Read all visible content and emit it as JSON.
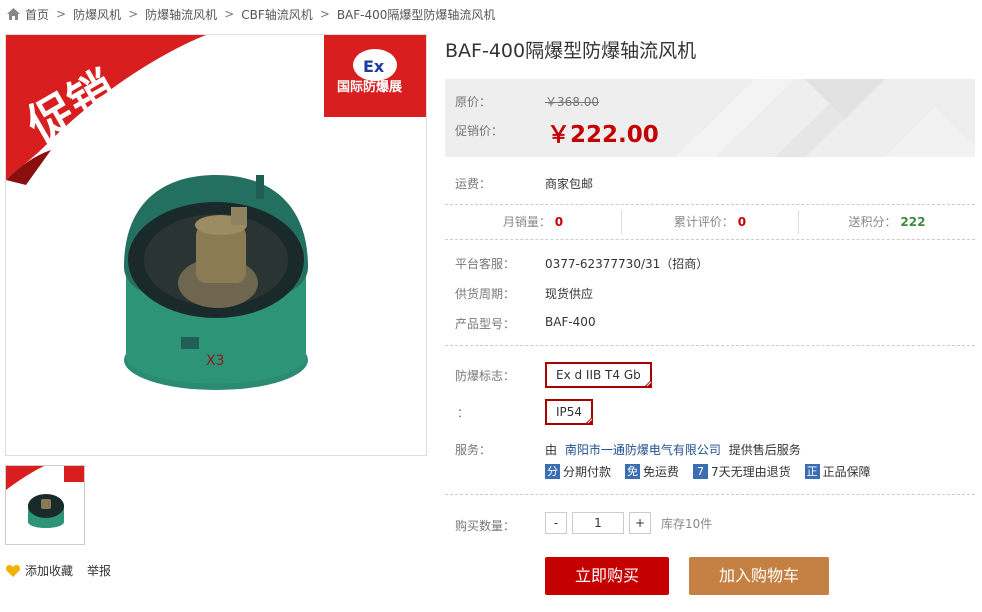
{
  "breadcrumb": {
    "items": [
      "首页",
      "防爆风机",
      "防爆轴流风机",
      "CBF轴流风机",
      "BAF-400隔爆型防爆轴流风机"
    ],
    "separator": ">"
  },
  "gallery": {
    "promo_banner": "促销",
    "brand_logo_text": "国际防爆展",
    "brand_logo_mark": "Ex"
  },
  "favorites": {
    "add_label": "添加收藏",
    "report_label": "举报"
  },
  "product": {
    "title": "BAF-400隔爆型防爆轴流风机",
    "original_price_label": "原价：",
    "original_price": "￥368.00",
    "sale_price_label": "促销价：",
    "sale_price": "￥222.00",
    "shipping_label": "运费：",
    "shipping_value": "商家包邮",
    "stats": [
      {
        "label": "月销量：",
        "value": "0"
      },
      {
        "label": "累计评价：",
        "value": "0"
      },
      {
        "label": "送积分：",
        "value": "222"
      }
    ],
    "service_phone_label": "平台客服：",
    "service_phone": "0377-62377730/31（招商）",
    "supply_label": "供货周期：",
    "supply_value": "现货供应",
    "model_label": "产品型号：",
    "model_value": "BAF-400",
    "explosion_label": "防爆标志：",
    "explosion_value": "Ex d IIB T4 Gb",
    "ip_label": "：",
    "ip_value": "IP54",
    "service_label": "服务：",
    "service_prefix": "由",
    "service_company": "南阳市一通防爆电气有限公司",
    "service_suffix": "提供售后服务",
    "guarantees": [
      {
        "tag": "分",
        "label": "分期付款"
      },
      {
        "tag": "免",
        "label": "免运费"
      },
      {
        "tag": "7",
        "label": "7天无理由退货"
      },
      {
        "tag": "正",
        "label": "正品保障"
      }
    ],
    "quantity_label": "购买数量：",
    "quantity_value": "1",
    "minus": "-",
    "plus": "+",
    "stock": "库存10件",
    "buy_now": "立即购买",
    "add_to_cart": "加入购物车"
  },
  "colors": {
    "accent": "#c40000",
    "cart": "#c58143",
    "link": "#1f4e8f"
  }
}
